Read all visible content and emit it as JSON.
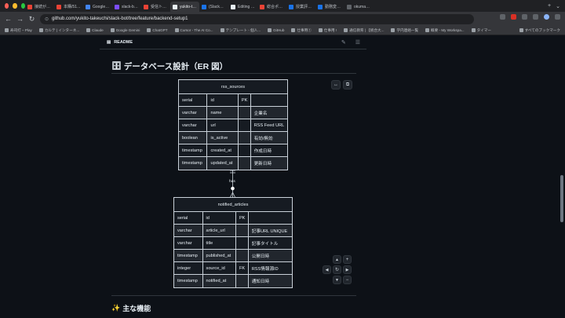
{
  "browser": {
    "tabs": [
      {
        "title": "接続が切断さ",
        "color": "#ea4335"
      },
      {
        "title": "本購/51140",
        "color": "#ea4335"
      },
      {
        "title": "Google カレ",
        "color": "#4285f4"
      },
      {
        "title": "slack-bot-C",
        "color": "#7c4dff"
      },
      {
        "title": "受信トレイ (3",
        "color": "#ea4335"
      },
      {
        "title": "yukito-takeu",
        "color": "#e6edf3"
      },
      {
        "title": "(Slack通知)",
        "color": "#1a73e8"
      },
      {
        "title": "Editing anun",
        "color": "#e6edf3"
      },
      {
        "title": "総合ポータル",
        "color": "#ea4335"
      },
      {
        "title": "授業評価 202",
        "color": "#1a73e8"
      },
      {
        "title": "勤務変換アプ",
        "color": "#1a73e8"
      },
      {
        "title": "okumana_",
        "color": "#5f6368"
      }
    ],
    "active_tab": 5,
    "url": "github.com/yukito-takeuchi/slack-bot/tree/feature/backend-setup1",
    "bookmarks": [
      "寿司打 – Play",
      "カルテ | インターネ...",
      "Claude",
      "Google Gemini",
      "ChatGPT",
      "Cursor - The AI Co...",
      "テンプレート - 個人...",
      "GitHub",
      "仕事用①",
      "仕事用 !",
      "通信教育 | 【統合大...",
      "学内連絡一覧",
      "概要 - My Workspa...",
      "タイマー"
    ],
    "bookmarks_all": "すべてのブックマーク"
  },
  "readme": {
    "label": "README",
    "heading": "データベース設計（ER 図）",
    "heading_emoji": "🗄",
    "next_heading": "主な機能",
    "next_heading_emoji": "✨"
  },
  "er": {
    "relation_label": "has",
    "tables": [
      {
        "name": "rss_sources",
        "rows": [
          [
            "serial",
            "id",
            "PK",
            ""
          ],
          [
            "varchar",
            "name",
            "",
            "企業名"
          ],
          [
            "varchar",
            "url",
            "",
            "RSS Feed URL"
          ],
          [
            "boolean",
            "is_active",
            "",
            "有効/無効"
          ],
          [
            "timestamp",
            "created_at",
            "",
            "作成日時"
          ],
          [
            "timestamp",
            "updated_at",
            "",
            "更新日時"
          ]
        ]
      },
      {
        "name": "notified_articles",
        "rows": [
          [
            "serial",
            "id",
            "PK",
            ""
          ],
          [
            "varchar",
            "article_url",
            "",
            "記事URL UNIQUE"
          ],
          [
            "varchar",
            "title",
            "",
            "記事タイトル"
          ],
          [
            "timestamp",
            "published_at",
            "",
            "公開日時"
          ],
          [
            "integer",
            "source_id",
            "FK",
            "RSS情報源ID"
          ],
          [
            "timestamp",
            "notified_at",
            "",
            "通知日時"
          ]
        ]
      }
    ]
  },
  "icons": {
    "expand": "↔",
    "copy": "⧉",
    "zoom_in": "+",
    "zoom_out": "−",
    "up": "▲",
    "down": "▼",
    "left": "◀",
    "right": "▶",
    "reset": "↻"
  }
}
